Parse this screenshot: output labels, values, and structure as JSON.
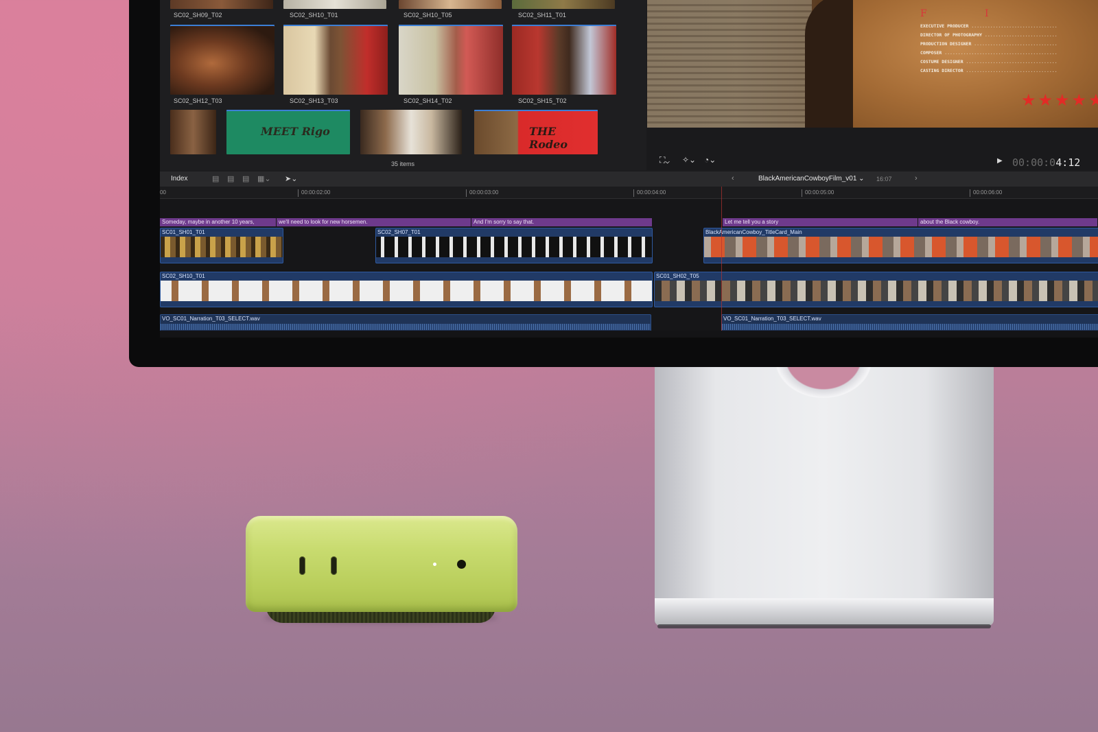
{
  "browser": {
    "rows": [
      [
        "SC02_SH09_T02",
        "SC02_SH10_T01",
        "SC02_SH10_T05",
        "SC02_SH11_T01"
      ],
      [
        "SC02_SH12_T03",
        "SC02_SH13_T03",
        "SC02_SH14_T02",
        "SC02_SH15_T02"
      ]
    ],
    "title_cards": [
      "MEET Rigo",
      "THE Rodeo"
    ],
    "items_count": "35 items"
  },
  "viewer": {
    "credits": [
      "EXECUTIVE PRODUCER",
      "DIRECTOR OF PHOTOGRAPHY",
      "PRODUCTION DESIGNER",
      "COMPOSER",
      "COSTUME DESIGNER",
      "CASTING DIRECTOR"
    ],
    "stars": "★★★★★",
    "timecode_dim": "00:00:0",
    "timecode_lit": "4:12"
  },
  "timeline_header": {
    "index_label": "Index",
    "project_name": "BlackAmericanCowboyFilm_v01",
    "project_duration": "16:07"
  },
  "ruler": {
    "ticks": [
      "00",
      "00:00:02:00",
      "00:00:03:00",
      "00:00:04:00",
      "00:00:05:00",
      "00:00:06:00"
    ]
  },
  "captions": [
    "Someday, maybe in another 10 years,",
    "we'll need to look for new horsemen.",
    "And I'm sorry to say that.",
    "Let me tell you a story",
    "about the Black cowboy."
  ],
  "clips": {
    "upper": [
      "SC01_SH01_T01",
      "SC02_SH07_T01",
      "BlackAmericanCowboy_TitleCard_Main"
    ],
    "primary": [
      "SC02_SH10_T01",
      "SC01_SH02_T05"
    ],
    "audio": [
      "VO_SC01_Narration_T03_SELECT.wav",
      "VO_SC01_Narration_T03_SELECT.wav"
    ]
  },
  "colors": {
    "caption": "#6e3a8c",
    "clip": "#213a66",
    "mac_mini": "#c8db6f",
    "playhead": "#b5322f"
  }
}
